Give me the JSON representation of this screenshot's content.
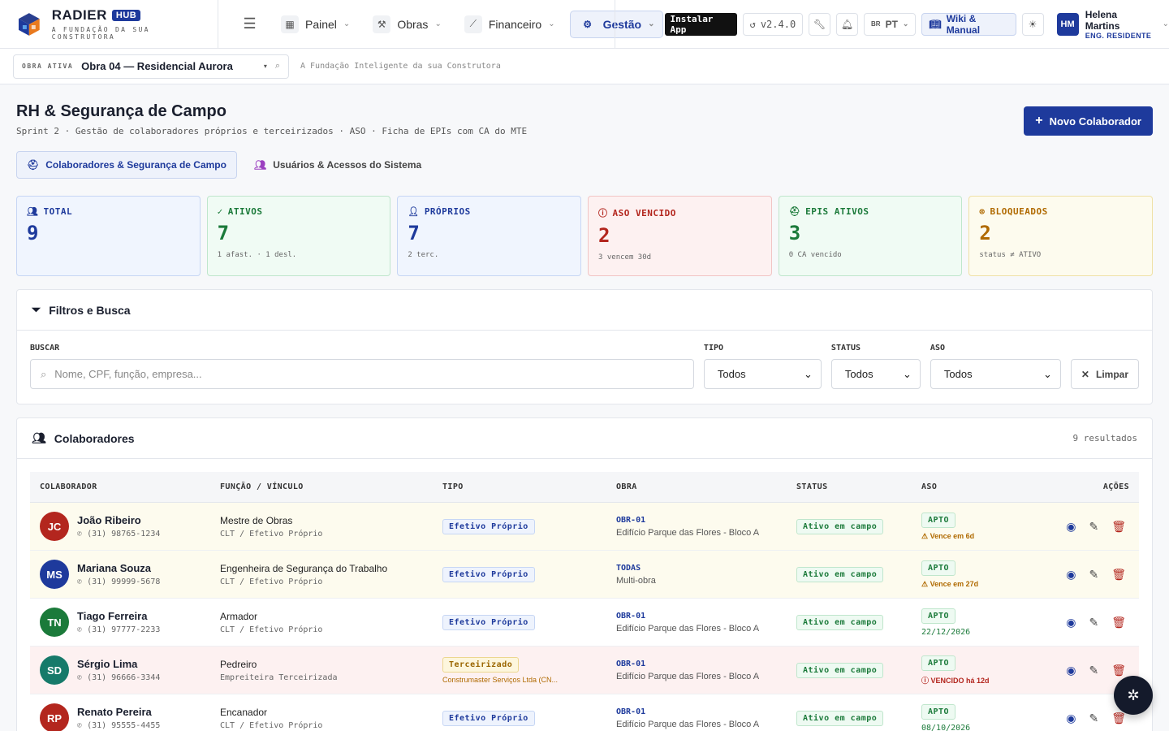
{
  "brand": {
    "name": "RADIER",
    "badge": "HUB",
    "tagline": "A FUNDAÇÃO DA SUA CONSTRUTORA"
  },
  "nav": [
    {
      "label": "Painel"
    },
    {
      "label": "Obras"
    },
    {
      "label": "Financeiro"
    },
    {
      "label": "Gestão"
    }
  ],
  "tools": {
    "install": "Instalar App",
    "version": "v2.4.0",
    "lang": "PT",
    "lang_flag": "BR",
    "wiki": "Wiki & Manual"
  },
  "user": {
    "initials": "HM",
    "name": "Helena Martins",
    "role": "ENG. RESIDENTE"
  },
  "obra": {
    "label": "OBRA ATIVA",
    "name": "Obra 04 — Residencial Aurora",
    "tagline": "A Fundação Inteligente da sua Construtora"
  },
  "page": {
    "title": "RH & Segurança de Campo",
    "subtitle": "Sprint 2 · Gestão de colaboradores próprios e terceirizados · ASO · Ficha de EPIs com CA do MTE",
    "new_button": "Novo Colaborador"
  },
  "tabs": [
    {
      "label": "Colaboradores & Segurança de Campo"
    },
    {
      "label": "Usuários & Acessos do Sistema"
    }
  ],
  "kpis": [
    {
      "label": "TOTAL",
      "value": "9",
      "note": ""
    },
    {
      "label": "ATIVOS",
      "value": "7",
      "note": "1 afast. · 1 desl."
    },
    {
      "label": "PRÓPRIOS",
      "value": "7",
      "note": "2 terc."
    },
    {
      "label": "ASO VENCIDO",
      "value": "2",
      "note": "3 vencem 30d"
    },
    {
      "label": "EPIS ATIVOS",
      "value": "3",
      "note": "0 CA vencido"
    },
    {
      "label": "BLOQUEADOS",
      "value": "2",
      "note": "status ≠ ATIVO"
    }
  ],
  "filters": {
    "title": "Filtros e Busca",
    "search_label": "BUSCAR",
    "search_placeholder": "Nome, CPF, função, empresa...",
    "tipo_label": "TIPO",
    "tipo_value": "Todos",
    "status_label": "STATUS",
    "status_value": "Todos",
    "aso_label": "ASO",
    "aso_value": "Todos",
    "clear": "Limpar"
  },
  "table": {
    "title": "Colaboradores",
    "results": "9 resultados",
    "headers": [
      "COLABORADOR",
      "FUNÇÃO / VÍNCULO",
      "TIPO",
      "OBRA",
      "STATUS",
      "ASO",
      "AÇÕES"
    ],
    "rows": [
      {
        "initials": "JC",
        "name": "João Ribeiro",
        "phone": "(31) 98765-1234",
        "funcao": "Mestre de Obras",
        "vinculo": "CLT / Efetivo Próprio",
        "tipo": "Efetivo Próprio",
        "tipo_sub": "",
        "obra_code": "OBR-01",
        "obra_name": "Edifício Parque das Flores - Bloco A",
        "status": "Ativo em campo",
        "aso": "APTO",
        "aso_note": "Vence em 6d",
        "aso_kind": "warn"
      },
      {
        "initials": "MS",
        "name": "Mariana Souza",
        "phone": "(31) 99999-5678",
        "funcao": "Engenheira de Segurança do Trabalho",
        "vinculo": "CLT / Efetivo Próprio",
        "tipo": "Efetivo Próprio",
        "tipo_sub": "",
        "obra_code": "TODAS",
        "obra_name": "Multi-obra",
        "status": "Ativo em campo",
        "aso": "APTO",
        "aso_note": "Vence em 27d",
        "aso_kind": "warn"
      },
      {
        "initials": "TN",
        "name": "Tiago Ferreira",
        "phone": "(31) 97777-2233",
        "funcao": "Armador",
        "vinculo": "CLT / Efetivo Próprio",
        "tipo": "Efetivo Próprio",
        "tipo_sub": "",
        "obra_code": "OBR-01",
        "obra_name": "Edifício Parque das Flores - Bloco A",
        "status": "Ativo em campo",
        "aso": "APTO",
        "aso_note": "22/12/2026",
        "aso_kind": "date"
      },
      {
        "initials": "SD",
        "name": "Sérgio Lima",
        "phone": "(31) 96666-3344",
        "funcao": "Pedreiro",
        "vinculo": "Empreiteira Terceirizada",
        "tipo": "Terceirizado",
        "tipo_sub": "Construmaster Serviços Ltda (CN...",
        "obra_code": "OBR-01",
        "obra_name": "Edifício Parque das Flores - Bloco A",
        "status": "Ativo em campo",
        "aso": "APTO",
        "aso_note": "VENCIDO há 12d",
        "aso_kind": "danger"
      },
      {
        "initials": "RP",
        "name": "Renato Pereira",
        "phone": "(31) 95555-4455",
        "funcao": "Encanador",
        "vinculo": "CLT / Efetivo Próprio",
        "tipo": "Efetivo Próprio",
        "tipo_sub": "",
        "obra_code": "OBR-01",
        "obra_name": "Edifício Parque das Flores - Bloco A",
        "status": "Ativo em campo",
        "aso": "APTO",
        "aso_note": "08/10/2026",
        "aso_kind": "date"
      }
    ]
  },
  "colors": {
    "primary": "#1e3a9c",
    "green": "#1b7a3a",
    "red": "#b3261e",
    "amber": "#b06a00"
  }
}
